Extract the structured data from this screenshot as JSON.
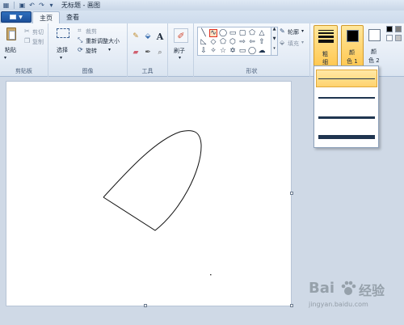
{
  "window": {
    "title": "无标题 - 画图"
  },
  "quick_access": [
    "save-icon",
    "undo-icon",
    "redo-icon",
    "customize-caret-icon"
  ],
  "tabs": {
    "home": "主页",
    "view": "查看"
  },
  "clipboard": {
    "paste": "粘贴",
    "cut": "剪切",
    "copy": "复制",
    "group": "剪贴板"
  },
  "image": {
    "select": "选择",
    "crop": "裁剪",
    "resize": "重新调整大小",
    "rotate": "旋转",
    "group": "图像"
  },
  "tools": {
    "group": "工具",
    "icons": [
      "pencil-icon",
      "fill-icon",
      "text-icon",
      "eraser-icon",
      "color-picker-icon",
      "magnifier-icon"
    ]
  },
  "brushes": {
    "label": "刷子"
  },
  "shapes": {
    "outline": "轮廓",
    "fill": "填充",
    "group": "形状",
    "selected": "curve"
  },
  "size": {
    "label1": "粗",
    "label2": "细",
    "options": [
      "1px",
      "3px",
      "5px",
      "8px"
    ],
    "highlighted": 0
  },
  "colors": {
    "color1_label": "颜",
    "color1_num": "色 1",
    "color2_label": "颜",
    "color2_num": "色 2",
    "color1": "#000000",
    "color2": "#ffffff",
    "palette": [
      "#000000",
      "#7f7f7f",
      "#ffffff",
      "#c3c3c3"
    ]
  },
  "watermark": {
    "brand": "Bai",
    "brand2": "经验",
    "url": "jingyan.baidu.com"
  }
}
